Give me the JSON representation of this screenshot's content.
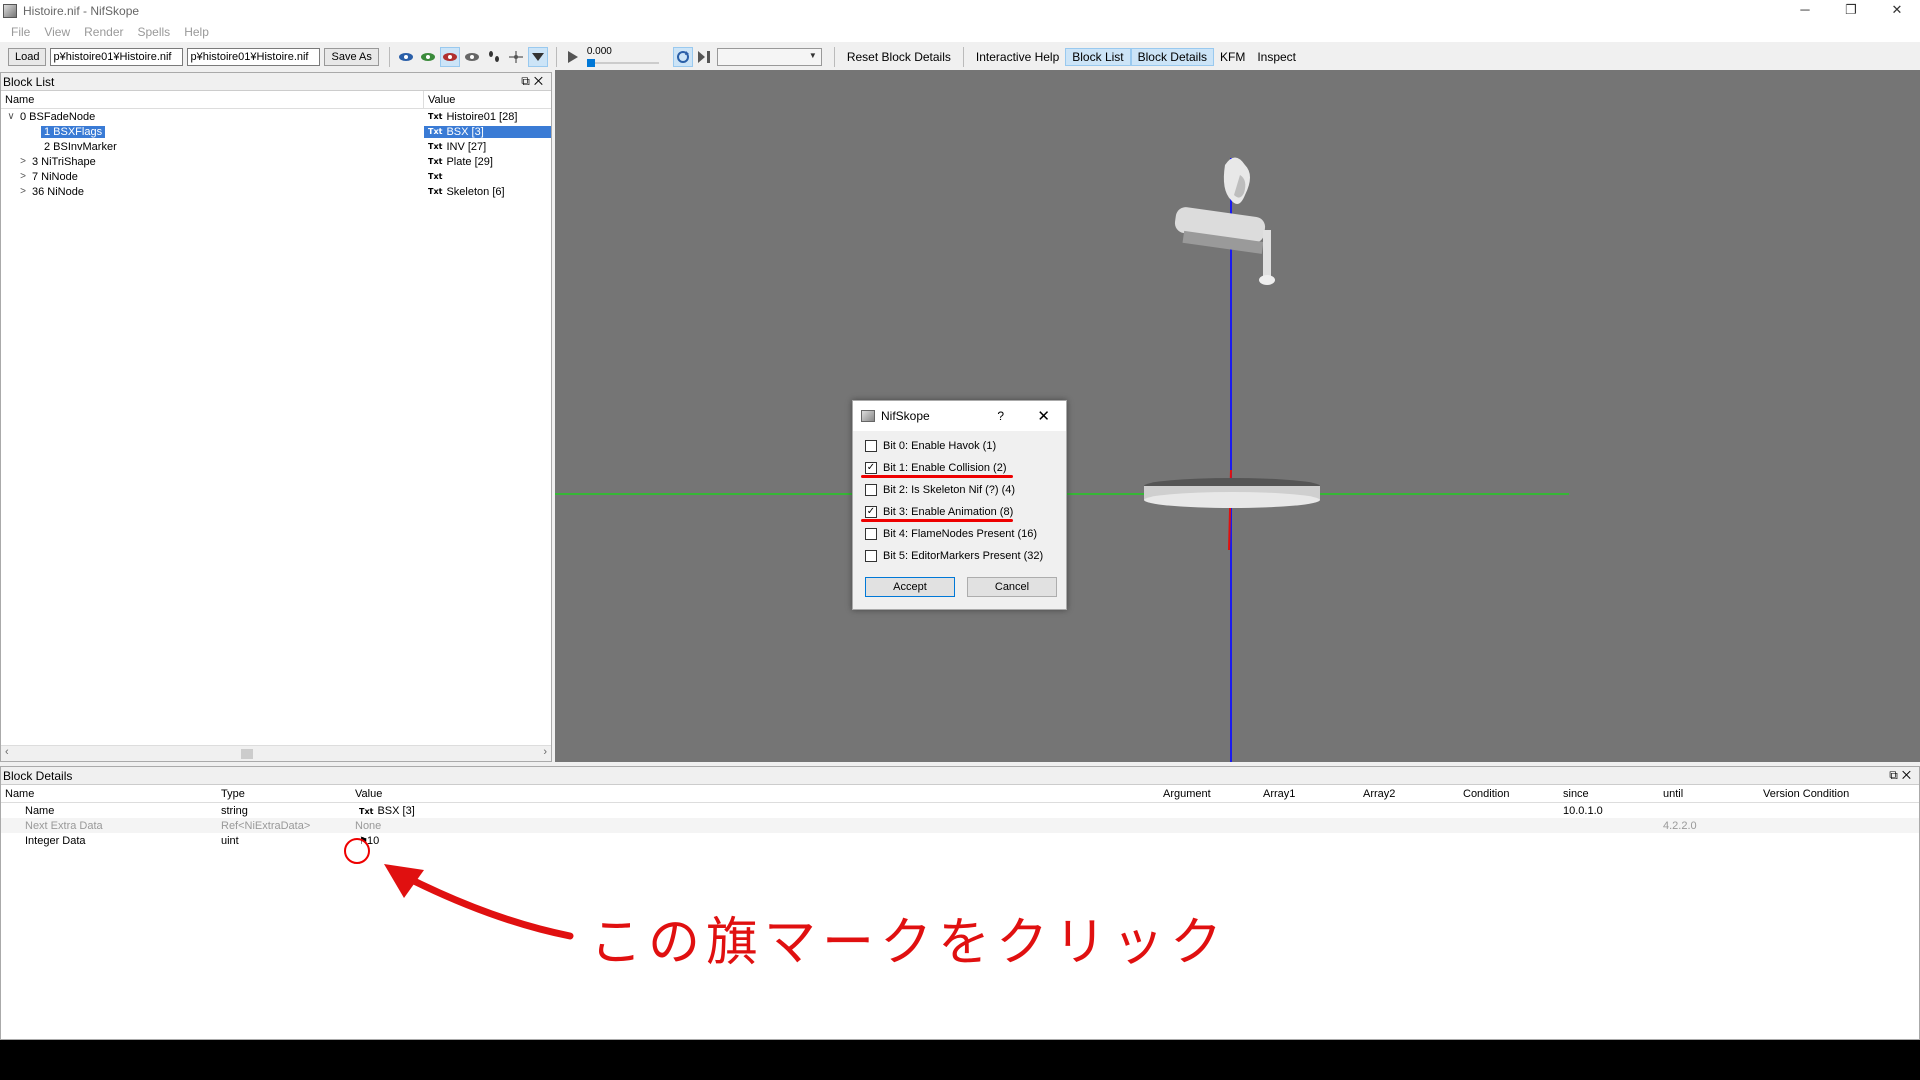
{
  "window": {
    "title": "Histoire.nif - NifSkope",
    "min": "─",
    "max": "❐",
    "close": "✕"
  },
  "menu": [
    "File",
    "View",
    "Render",
    "Spells",
    "Help"
  ],
  "toolbar": {
    "load": "Load",
    "path1": "p¥histoire01¥Histoire.nif",
    "path2": "p¥histoire01¥Histoire.nif",
    "save_as": "Save As",
    "time_value": "0.000",
    "reset_block_details": "Reset Block Details",
    "interactive_help": "Interactive Help",
    "block_list": "Block List",
    "block_details": "Block Details",
    "kfm": "KFM",
    "inspect": "Inspect"
  },
  "block_list": {
    "title": "Block List",
    "columns": {
      "name": "Name",
      "value": "Value"
    },
    "rows": [
      {
        "expander": "∨",
        "name": "0 BSFadeNode",
        "value": "Histoire01 [28]",
        "indent": 0
      },
      {
        "expander": "",
        "name": "1 BSXFlags",
        "value": "BSX [3]",
        "indent": 2,
        "selected": true
      },
      {
        "expander": "",
        "name": "2 BSInvMarker",
        "value": "INV [27]",
        "indent": 2
      },
      {
        "expander": ">",
        "name": "3 NiTriShape",
        "value": "Plate [29]",
        "indent": 1
      },
      {
        "expander": ">",
        "name": "7 NiNode",
        "value": "",
        "indent": 1
      },
      {
        "expander": ">",
        "name": "36 NiNode",
        "value": "Skeleton [6]",
        "indent": 1
      }
    ]
  },
  "dialog": {
    "title": "NifSkope",
    "help": "?",
    "close": "✕",
    "options": [
      {
        "label": "Bit 0: Enable Havok (1)",
        "checked": false,
        "underline": false
      },
      {
        "label": "Bit 1: Enable Collision (2)",
        "checked": true,
        "underline": true
      },
      {
        "label": "Bit 2: Is Skeleton Nif (?) (4)",
        "checked": false,
        "underline": false
      },
      {
        "label": "Bit 3: Enable Animation (8)",
        "checked": true,
        "underline": true
      },
      {
        "label": "Bit 4: FlameNodes Present (16)",
        "checked": false,
        "underline": false
      },
      {
        "label": "Bit 5: EditorMarkers Present (32)",
        "checked": false,
        "underline": false
      }
    ],
    "accept": "Accept",
    "cancel": "Cancel"
  },
  "block_details": {
    "title": "Block Details",
    "columns": [
      "Name",
      "Type",
      "Value",
      "Argument",
      "Array1",
      "Array2",
      "Condition",
      "since",
      "until",
      "Version Condition"
    ],
    "rows": [
      {
        "name": "Name",
        "type": "string",
        "value": "BSX [3]",
        "since": "10.0.1.0",
        "until": "",
        "grey": false,
        "txt": true
      },
      {
        "name": "Next Extra Data",
        "type": "Ref<NiExtraData>",
        "value": "None",
        "since": "",
        "until": "4.2.2.0",
        "grey": true,
        "txt": false
      },
      {
        "name": "Integer Data",
        "type": "uint",
        "value": "10",
        "since": "",
        "until": "",
        "grey": false,
        "txt": false,
        "flag": true
      }
    ]
  },
  "annotation": {
    "text": "この旗マークをクリック",
    "color": "#e01010"
  },
  "colors": {
    "viewport_bg": "#757575",
    "selection": "#3a7bd5",
    "annotation_red": "#e01010"
  }
}
